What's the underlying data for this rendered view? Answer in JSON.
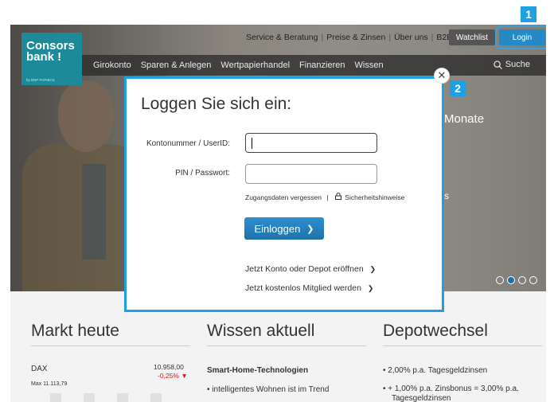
{
  "logo": {
    "line1": "Consors",
    "line2": "bank !",
    "sub": "by BNP PARIBAS"
  },
  "toplinks": {
    "service": "Service & Beratung",
    "preise": "Preise & Zinsen",
    "ueber": "Über uns",
    "b2b": "B2B"
  },
  "buttons": {
    "watchlist": "Watchlist",
    "login": "Login"
  },
  "mainnav": {
    "items": [
      "Girokonto",
      "Sparen & Anlegen",
      "Wertpapierhandel",
      "Finanzieren",
      "Wissen"
    ],
    "search": "Suche"
  },
  "hero": {
    "text1": "Monate",
    "text2": "s"
  },
  "modal": {
    "title": "Loggen Sie sich ein:",
    "user_label": "Kontonummer / UserID:",
    "user_value": "",
    "pin_label": "PIN / Passwort:",
    "pin_value": "",
    "forgot": "Zugangsdaten vergessen",
    "sep": "|",
    "security": "Sicherheitshinweise",
    "submit": "Einloggen",
    "submit_arrow": "❯",
    "link1": "Jetzt Konto oder Depot eröffnen",
    "link2": "Jetzt kostenlos Mitglied werden",
    "chevron": "❯"
  },
  "badges": {
    "one": "1",
    "two": "2"
  },
  "sections": {
    "markt": {
      "title": "Markt heute",
      "index_name": "DAX",
      "index_value": "10.958,00",
      "index_change": "-0,25%",
      "max_label": "Max 11.113,79"
    },
    "wissen": {
      "title": "Wissen aktuell",
      "headline": "Smart-Home-Technologien",
      "bullet1": "intelligentes Wohnen ist im Trend"
    },
    "depot": {
      "title": "Depotwechsel",
      "bullet1": "2,00% p.a. Tagesgeldzinsen",
      "bullet2": "+ 1,00% p.a. Zinsbonus = 3,00% p.a.",
      "bullet3": "Tagesgeldzinsen"
    }
  },
  "colors": {
    "accent": "#1da1e2",
    "brand": "#1d8a99",
    "button": "#2489c5",
    "negative": "#d12020"
  }
}
